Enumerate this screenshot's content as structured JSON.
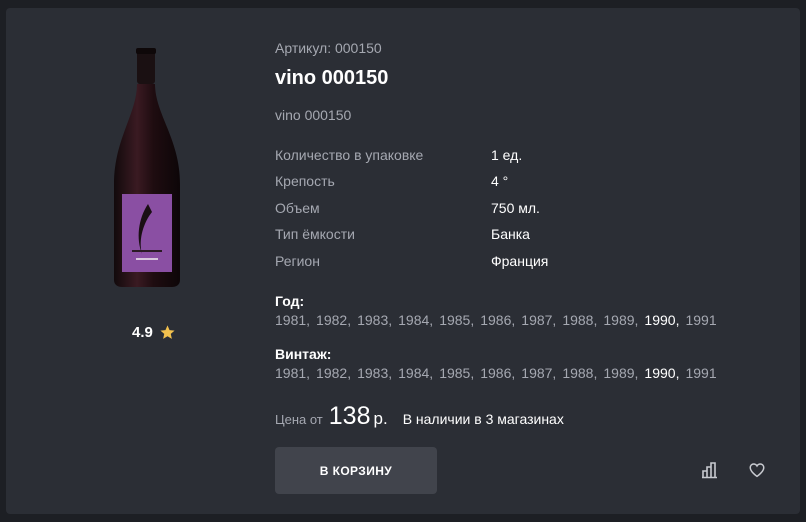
{
  "product": {
    "sku_label": "Артикул: 000150",
    "title": "vino 000150",
    "subtitle": "vino 000150",
    "rating": "4.9"
  },
  "specs": [
    {
      "label": "Количество в упаковке",
      "value": "1 ед."
    },
    {
      "label": "Крепость",
      "value": "4 °"
    },
    {
      "label": "Объем",
      "value": "750 мл."
    },
    {
      "label": "Тип ёмкости",
      "value": "Банка"
    },
    {
      "label": "Регион",
      "value": "Франция"
    }
  ],
  "year": {
    "heading": "Год:",
    "options": [
      "1981,",
      "1982,",
      "1983,",
      "1984,",
      "1985,",
      "1986,",
      "1987,",
      "1988,",
      "1989,",
      "1990,",
      "1991"
    ],
    "selected_index": 9
  },
  "vintage": {
    "heading": "Винтаж:",
    "options": [
      "1981,",
      "1982,",
      "1983,",
      "1984,",
      "1985,",
      "1986,",
      "1987,",
      "1988,",
      "1989,",
      "1990,",
      "1991"
    ],
    "selected_index": 9
  },
  "price": {
    "prefix": "Цена от",
    "value": "138",
    "currency": "р.",
    "availability": "В наличии в 3 магазинах"
  },
  "actions": {
    "cart_label": "В КОРЗИНУ",
    "compare_icon": "compare-icon",
    "favorite_icon": "heart-icon"
  },
  "colors": {
    "background": "#1d1f24",
    "card": "#2b2e35",
    "button": "#41444c",
    "star": "#f2c14e",
    "label_purple": "#8a4fa3"
  }
}
